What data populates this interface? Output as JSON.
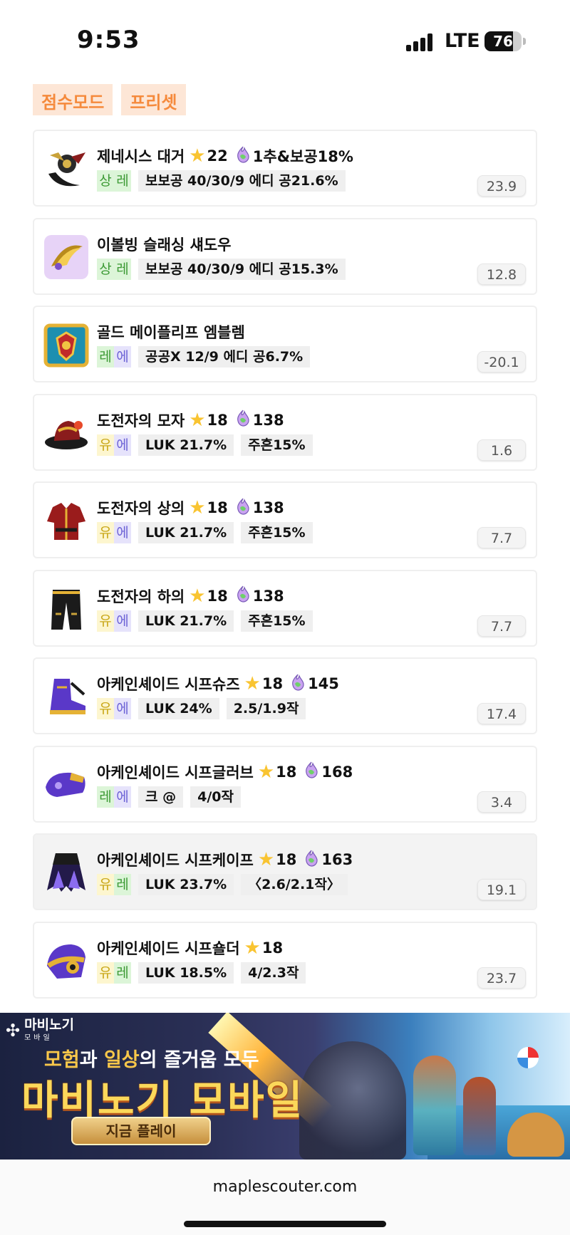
{
  "status_bar": {
    "time": "9:53",
    "network": "LTE",
    "battery": "76",
    "battery_level": 0.76
  },
  "tabs": [
    {
      "label": "점수모드"
    },
    {
      "label": "프리셋"
    }
  ],
  "items": [
    {
      "name": "제네시스 대거",
      "stars": "22",
      "flame": "1추&보공18%",
      "grade": [
        "상",
        "레"
      ],
      "grade_colors": [
        "#dcf5d8",
        "#dcf5d8"
      ],
      "grade_text": [
        "#3c9a34",
        "#3c9a34"
      ],
      "stats": [
        "보보공 40/30/9 에디 공21.6%"
      ],
      "score": "23.9",
      "icon": "genesis-dagger-icon"
    },
    {
      "name": "이볼빙 슬래싱 섀도우",
      "stars": "",
      "flame": "",
      "grade": [
        "상",
        "레"
      ],
      "grade_colors": [
        "#dcf5d8",
        "#dcf5d8"
      ],
      "grade_text": [
        "#3c9a34",
        "#3c9a34"
      ],
      "stats": [
        "보보공 40/30/9 에디 공15.3%"
      ],
      "score": "12.8",
      "icon": "evolving-slashing-shadow-icon"
    },
    {
      "name": "골드 메이플리프 엠블렘",
      "stars": "",
      "flame": "",
      "grade": [
        "레",
        "에"
      ],
      "grade_colors": [
        "#dcf5d8",
        "#e6e3fb"
      ],
      "grade_text": [
        "#3c9a34",
        "#6d63d6"
      ],
      "stats": [
        "공공X 12/9 에디 공6.7%"
      ],
      "score": "-20.1",
      "icon": "gold-maple-leaf-emblem-icon"
    },
    {
      "name": "도전자의 모자",
      "stars": "18",
      "flame": "138",
      "grade": [
        "유",
        "에"
      ],
      "grade_colors": [
        "#fdf6cf",
        "#e6e3fb"
      ],
      "grade_text": [
        "#c9a718",
        "#6d63d6"
      ],
      "stats": [
        "LUK 21.7%",
        "주흔15%"
      ],
      "score": "1.6",
      "icon": "challenger-hat-icon"
    },
    {
      "name": "도전자의 상의",
      "stars": "18",
      "flame": "138",
      "grade": [
        "유",
        "에"
      ],
      "grade_colors": [
        "#fdf6cf",
        "#e6e3fb"
      ],
      "grade_text": [
        "#c9a718",
        "#6d63d6"
      ],
      "stats": [
        "LUK 21.7%",
        "주흔15%"
      ],
      "score": "7.7",
      "icon": "challenger-top-icon"
    },
    {
      "name": "도전자의 하의",
      "stars": "18",
      "flame": "138",
      "grade": [
        "유",
        "에"
      ],
      "grade_colors": [
        "#fdf6cf",
        "#e6e3fb"
      ],
      "grade_text": [
        "#c9a718",
        "#6d63d6"
      ],
      "stats": [
        "LUK 21.7%",
        "주흔15%"
      ],
      "score": "7.7",
      "icon": "challenger-bottom-icon"
    },
    {
      "name": "아케인셰이드 시프슈즈",
      "stars": "18",
      "flame": "145",
      "grade": [
        "유",
        "에"
      ],
      "grade_colors": [
        "#fdf6cf",
        "#e6e3fb"
      ],
      "grade_text": [
        "#c9a718",
        "#6d63d6"
      ],
      "stats": [
        "LUK 24%",
        "2.5/1.9작"
      ],
      "score": "17.4",
      "icon": "arcane-thief-shoes-icon"
    },
    {
      "name": "아케인셰이드 시프글러브",
      "stars": "18",
      "flame": "168",
      "grade": [
        "레",
        "에"
      ],
      "grade_colors": [
        "#dcf5d8",
        "#e6e3fb"
      ],
      "grade_text": [
        "#3c9a34",
        "#6d63d6"
      ],
      "stats": [
        "크 @",
        "4/0작"
      ],
      "score": "3.4",
      "icon": "arcane-thief-gloves-icon"
    },
    {
      "name": "아케인셰이드 시프케이프",
      "stars": "18",
      "flame": "163",
      "grade": [
        "유",
        "레"
      ],
      "grade_colors": [
        "#fdf6cf",
        "#dcf5d8"
      ],
      "grade_text": [
        "#c9a718",
        "#3c9a34"
      ],
      "stats": [
        "LUK 23.7%",
        "〈2.6/2.1작〉"
      ],
      "score": "19.1",
      "icon": "arcane-thief-cape-icon",
      "selected": true
    },
    {
      "name": "아케인셰이드 시프숄더",
      "stars": "18",
      "flame": "",
      "grade": [
        "유",
        "레"
      ],
      "grade_colors": [
        "#fdf6cf",
        "#dcf5d8"
      ],
      "grade_text": [
        "#c9a718",
        "#3c9a34"
      ],
      "stats": [
        "LUK 18.5%",
        "4/2.3작"
      ],
      "score": "23.7",
      "icon": "arcane-thief-shoulder-icon"
    }
  ],
  "ad": {
    "logo": "마비노기",
    "logo_sub": "모바일",
    "line1_a": "모험",
    "line1_b": "과 ",
    "line1_c": "일상",
    "line1_d": "의 즐거움 모두",
    "line2": "마비노기 모바일",
    "cta": "지금 플레이"
  },
  "footer": {
    "domain": "maplescouter.com"
  }
}
